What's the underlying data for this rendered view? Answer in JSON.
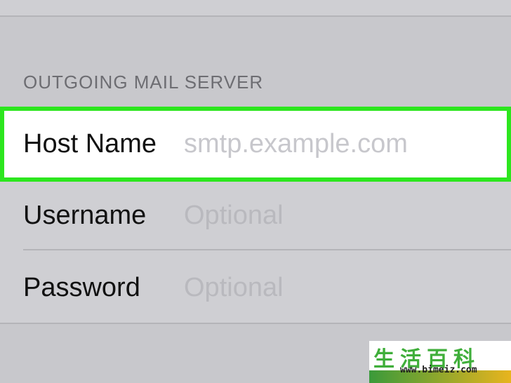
{
  "section": {
    "header": "OUTGOING MAIL SERVER"
  },
  "fields": [
    {
      "label": "Host Name",
      "placeholder": "smtp.example.com",
      "value": ""
    },
    {
      "label": "Username",
      "placeholder": "Optional",
      "value": ""
    },
    {
      "label": "Password",
      "placeholder": "Optional",
      "value": ""
    }
  ],
  "highlight": {
    "color": "#2ce61e",
    "field_index": 0
  },
  "watermark": {
    "title": "生活百科",
    "url": "www.bimeiz.com"
  }
}
